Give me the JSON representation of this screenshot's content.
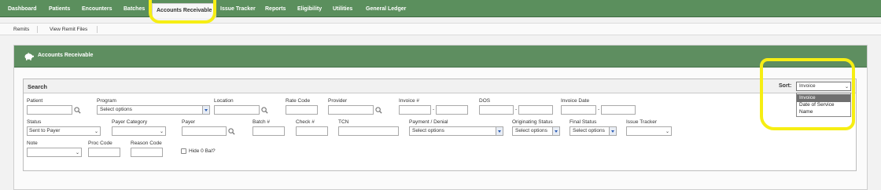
{
  "topnav": {
    "items": [
      "Dashboard",
      "Patients",
      "Encounters",
      "Batches",
      "Accounts Receivable",
      "Issue Tracker",
      "Reports",
      "Eligibility",
      "Utilities",
      "General Ledger"
    ],
    "active_index": 4
  },
  "subnav": {
    "items": [
      "Remits",
      "View Remit Files"
    ]
  },
  "panel": {
    "title": "Accounts Receivable",
    "icon": "piggy-bank-icon"
  },
  "search": {
    "title": "Search",
    "sort": {
      "label": "Sort:",
      "selected": "Invoice",
      "options": [
        "Invoice",
        "Date of Service",
        "Name"
      ]
    },
    "row1": {
      "patient": "Patient",
      "program": "Program",
      "program_value": "Select options",
      "location": "Location",
      "rate_code": "Rate Code",
      "provider": "Provider",
      "invoice_no": "Invoice #",
      "dos": "DOS",
      "invoice_date": "Invoice Date",
      "range_sep": "-"
    },
    "row2": {
      "status": "Status",
      "status_value": "Sent to Payer",
      "payer_category": "Payer Category",
      "payer": "Payer",
      "batch_no": "Batch #",
      "check_no": "Check #",
      "tcn": "TCN",
      "payment_denial": "Payment / Denial",
      "payment_denial_value": "Select options",
      "originating_status": "Originating Status",
      "originating_status_value": "Select options",
      "final_status": "Final Status",
      "final_status_value": "Select options",
      "issue_tracker": "Issue Tracker"
    },
    "row3": {
      "note": "Note",
      "proc_code": "Proc Code",
      "reason_code": "Reason Code",
      "hide_zero_bal": "Hide 0 Bal?"
    }
  },
  "colors": {
    "nav_green": "#5b8f5d",
    "panel_green": "#5e8e60",
    "highlight_yellow": "#f6ee13"
  }
}
